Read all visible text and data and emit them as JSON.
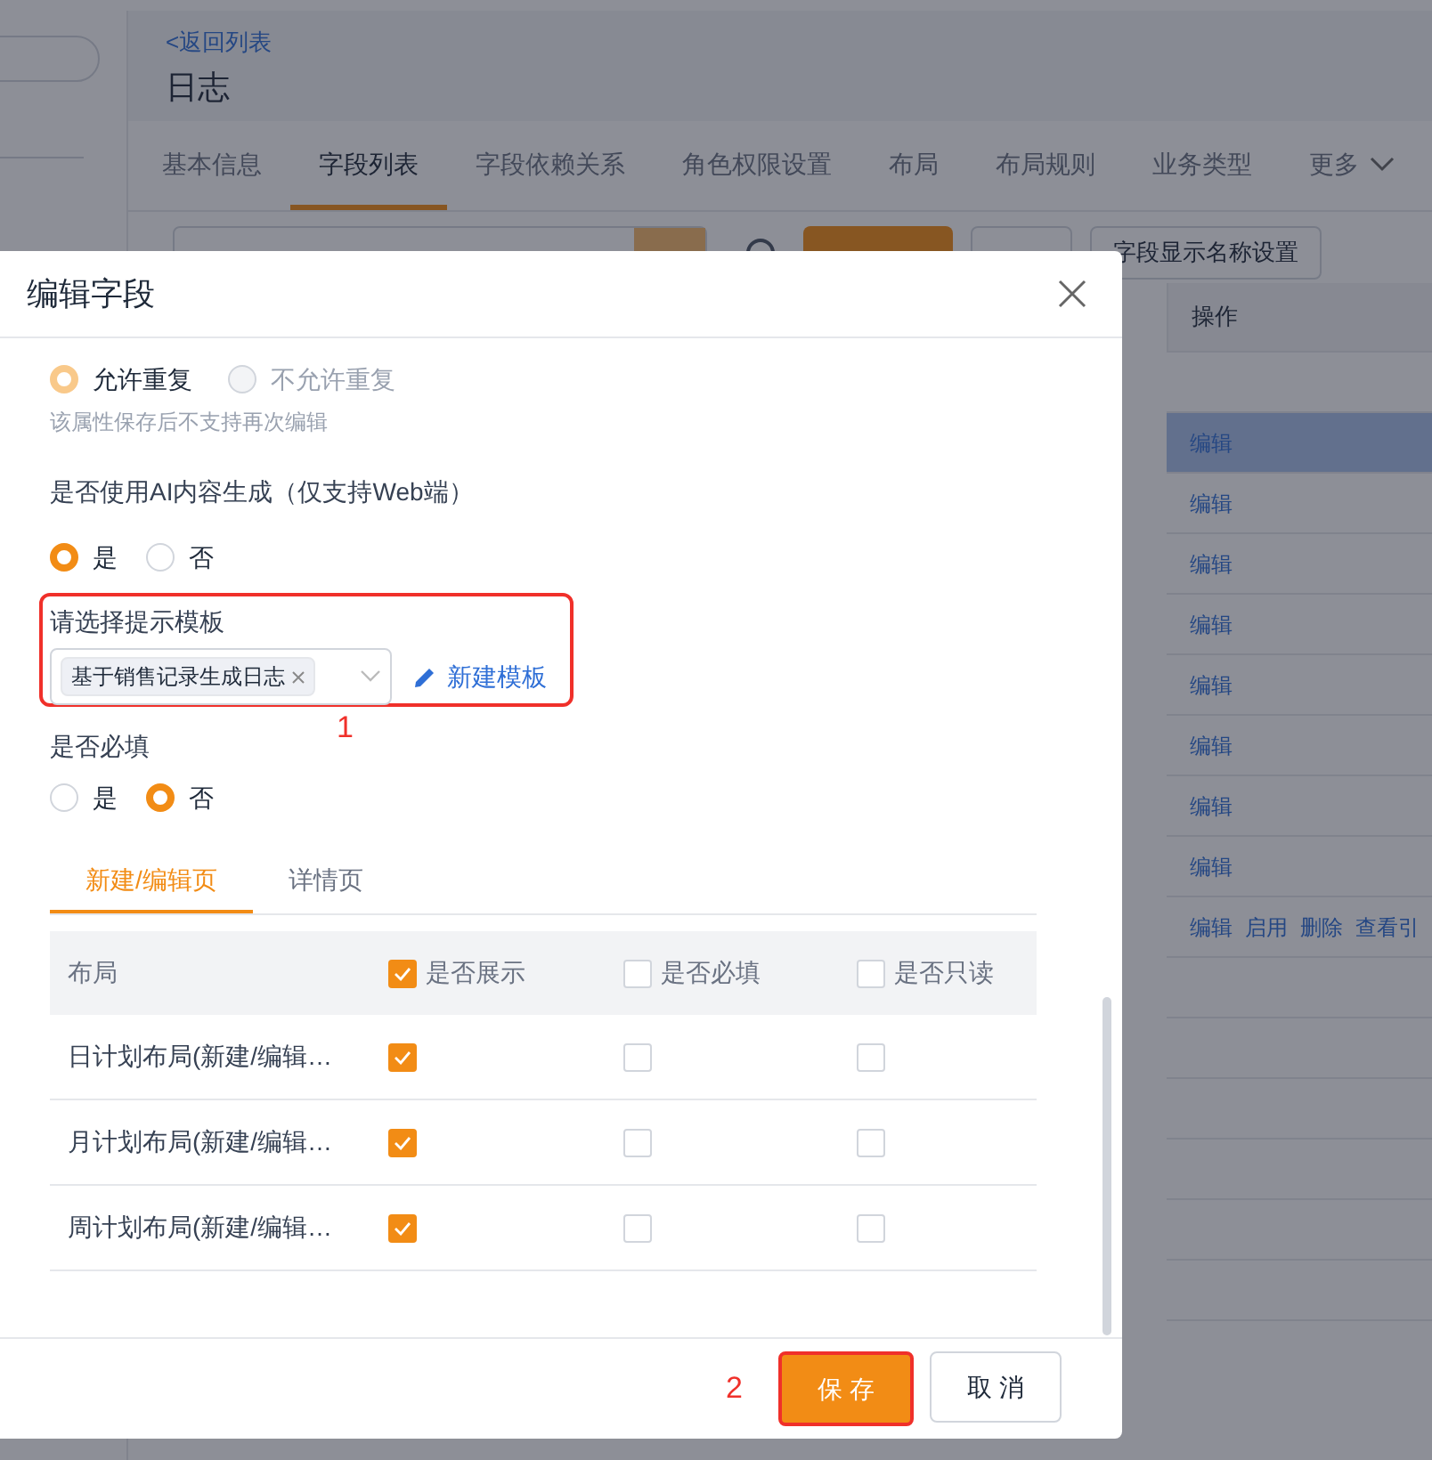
{
  "page": {
    "back_link": "<返回列表",
    "title": "日志",
    "tabs": [
      {
        "label": "基本信息",
        "selected": false
      },
      {
        "label": "字段列表",
        "selected": true
      },
      {
        "label": "字段依赖关系",
        "selected": false
      },
      {
        "label": "角色权限设置",
        "selected": false
      },
      {
        "label": "布局",
        "selected": false
      },
      {
        "label": "布局规则",
        "selected": false
      },
      {
        "label": "业务类型",
        "selected": false
      },
      {
        "label": "更多",
        "selected": false
      }
    ],
    "toolbar_button": "字段显示名称设置",
    "table": {
      "column": "操作",
      "rows": [
        {
          "actions": [],
          "selected": false
        },
        {
          "actions": [
            "编辑"
          ],
          "selected": true
        },
        {
          "actions": [
            "编辑"
          ],
          "selected": false
        },
        {
          "actions": [
            "编辑"
          ],
          "selected": false
        },
        {
          "actions": [
            "编辑"
          ],
          "selected": false
        },
        {
          "actions": [
            "编辑"
          ],
          "selected": false
        },
        {
          "actions": [
            "编辑"
          ],
          "selected": false
        },
        {
          "actions": [
            "编辑"
          ],
          "selected": false
        },
        {
          "actions": [
            "编辑"
          ],
          "selected": false
        },
        {
          "actions": [
            "编辑",
            "启用",
            "删除",
            "查看引"
          ],
          "selected": false
        },
        {
          "actions": [],
          "selected": false
        },
        {
          "actions": [],
          "selected": false
        },
        {
          "actions": [],
          "selected": false
        },
        {
          "actions": [],
          "selected": false
        },
        {
          "actions": [],
          "selected": false
        },
        {
          "actions": [],
          "selected": false
        },
        {
          "actions": [],
          "selected": false
        }
      ]
    }
  },
  "dialog": {
    "title": "编辑字段",
    "duplicate": {
      "options": [
        {
          "label": "允许重复",
          "selected": true,
          "disabled": true
        },
        {
          "label": "不允许重复",
          "selected": false,
          "disabled": true
        }
      ],
      "hint": "该属性保存后不支持再次编辑"
    },
    "ai": {
      "label": "是否使用AI内容生成（仅支持Web端）",
      "options": [
        {
          "label": "是",
          "selected": true,
          "disabled": false
        },
        {
          "label": "否",
          "selected": false,
          "disabled": false
        }
      ]
    },
    "template": {
      "label": "请选择提示模板",
      "tags": [
        "基于销售记录生成日志"
      ],
      "new_link": "新建模板"
    },
    "required": {
      "label": "是否必填",
      "options": [
        {
          "label": "是",
          "selected": false,
          "disabled": false
        },
        {
          "label": "否",
          "selected": true,
          "disabled": false
        }
      ]
    },
    "tabs": [
      {
        "label": "新建/编辑页",
        "selected": true
      },
      {
        "label": "详情页",
        "selected": false
      }
    ],
    "layout_table": {
      "columns": [
        {
          "label": "布局"
        },
        {
          "label": "是否展示",
          "checked": true
        },
        {
          "label": "是否必填",
          "checked": false
        },
        {
          "label": "是否只读",
          "checked": false
        }
      ],
      "rows": [
        {
          "name": "日计划布局(新建/编辑…",
          "show": true,
          "required": false,
          "readonly": false
        },
        {
          "name": "月计划布局(新建/编辑…",
          "show": true,
          "required": false,
          "readonly": false
        },
        {
          "name": "周计划布局(新建/编辑…",
          "show": true,
          "required": false,
          "readonly": false
        }
      ]
    },
    "buttons": [
      {
        "label": "保 存",
        "kind": "primary"
      },
      {
        "label": "取 消",
        "kind": "default"
      }
    ]
  },
  "annotations": [
    {
      "label": "1"
    },
    {
      "label": "2"
    }
  ]
}
